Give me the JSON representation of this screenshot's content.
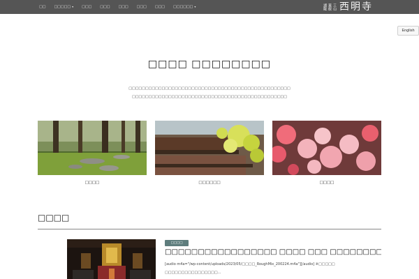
{
  "nav": {
    "items": [
      {
        "label": "□□",
        "dropdown": false
      },
      {
        "label": "□□□□□",
        "dropdown": true
      },
      {
        "label": "□□□",
        "dropdown": false
      },
      {
        "label": "□□□",
        "dropdown": false
      },
      {
        "label": "□□□",
        "dropdown": false
      },
      {
        "label": "□□□",
        "dropdown": false
      },
      {
        "label": "□□□",
        "dropdown": false
      },
      {
        "label": "□□□□□□",
        "dropdown": true
      }
    ],
    "caret": "▾"
  },
  "logo": {
    "small_col1": "三山",
    "small_col2": "東叡",
    "small_col3": "湖龍",
    "main": "西明寺"
  },
  "lang_button": "English",
  "page_title": "□□□□ □□□□□□□□",
  "intro": {
    "line1": "□□□□□□□□□□□□□□□□□□□□□□□□□□□□□□□□□□□□□□□□□□□□□□□□□",
    "line2": "□□□□□□□□□□□□□□□□□□□□□□□□□□□□□□□□□□□□□□□□□□□□□□□"
  },
  "cards": [
    {
      "caption": "□□□□"
    },
    {
      "caption": "□□□□□□"
    },
    {
      "caption": "□□□□"
    }
  ],
  "news": {
    "section_title": "□□□□",
    "badge": "□□□□",
    "title": "□□□□□□□□□□□□□□□□□ □□□□ □□□ □□□□□□□□",
    "excerpt_line1": "[audio m4a=\"/wp-content/uploads/2023/05/□□□□_RoughMix_200224.m4a\"][/audio] ※□□□□□",
    "excerpt_line2": "□□□□□□□□□□□□□□□□…"
  },
  "colors": {
    "navbar": "#555555",
    "badge": "#5e7d7d"
  }
}
